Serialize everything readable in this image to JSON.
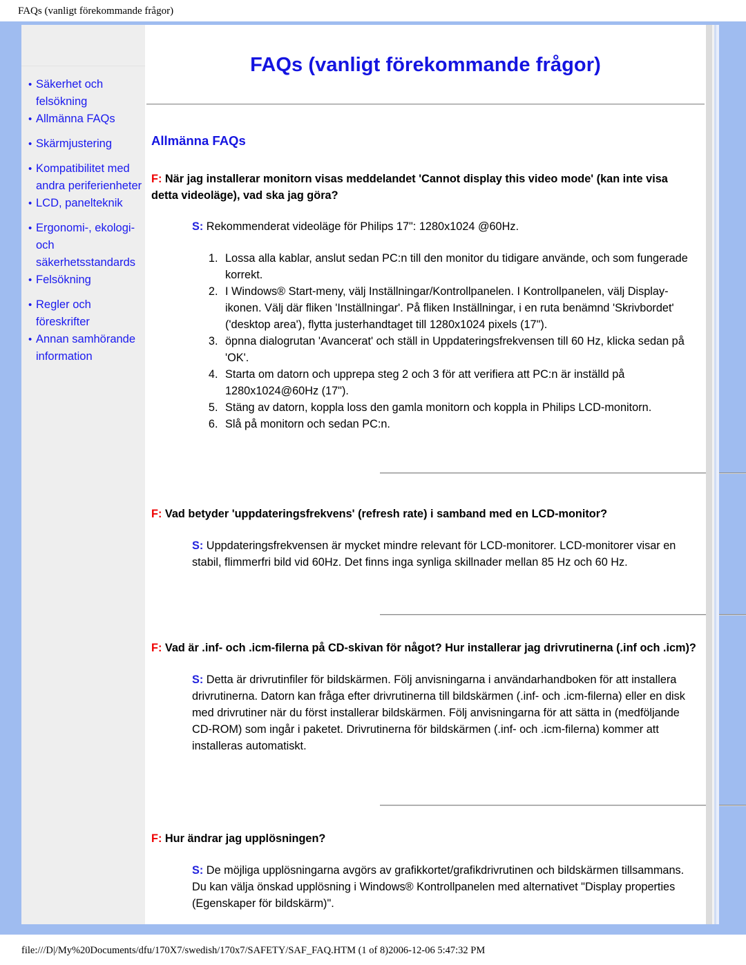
{
  "print": {
    "header": "FAQs (vanligt förekommande frågor)",
    "footer": "file:///D|/My%20Documents/dfu/170X7/swedish/170x7/SAFETY/SAF_FAQ.HTM (1 of 8)2006-12-06 5:47:32 PM"
  },
  "colors": {
    "frame_blue": "#9fbcf0",
    "sidebar_gray": "#eeeeee",
    "link_blue": "#1a1aee",
    "heading_blue": "#1414e0",
    "question_red": "#ee0000",
    "answer_blue": "#2222dd"
  },
  "sidebar": {
    "items": [
      {
        "label": "Säkerhet och felsökning",
        "gap": false
      },
      {
        "label": "Allmänna FAQs",
        "gap": false
      },
      {
        "label": "Skärmjustering",
        "gap": true
      },
      {
        "label": "Kompatibilitet med andra periferienheter",
        "gap": true
      },
      {
        "label": "LCD, panelteknik",
        "gap": false
      },
      {
        "label": "Ergonomi-, ekologi- och säkerhetsstandards",
        "gap": true
      },
      {
        "label": "Felsökning",
        "gap": false
      },
      {
        "label": "Regler och föreskrifter",
        "gap": true
      },
      {
        "label": "Annan samhörande information",
        "gap": false
      }
    ]
  },
  "main": {
    "title": "FAQs (vanligt förekommande frågor)",
    "section_title": "Allmänna FAQs",
    "q_marker": "F:",
    "a_marker": "S:",
    "qa": [
      {
        "question": "När jag installerar monitorn visas meddelandet 'Cannot display this video mode' (kan inte visa detta videoläge), vad ska jag göra?",
        "answer": "Rekommenderat videoläge för Philips 17\": 1280x1024 @60Hz.",
        "steps": [
          "Lossa alla kablar, anslut sedan PC:n till den monitor du tidigare använde, och som fungerade korrekt.",
          "I Windows® Start-meny, välj Inställningar/Kontrollpanelen. I Kontrollpanelen, välj Display-ikonen. Välj där fliken 'Inställningar'. På fliken Inställningar, i en ruta benämnd 'Skrivbordet' ('desktop area'), flytta justerhandtaget till 1280x1024 pixels (17\").",
          "öpnna dialogrutan 'Avancerat' och ställ in Uppdateringsfrekvensen till 60 Hz, klicka sedan på 'OK'.",
          "Starta om datorn och upprepa steg 2 och 3 för att verifiera att PC:n är inställd på 1280x1024@60Hz (17\").",
          "Stäng av datorn, koppla loss den gamla monitorn och koppla in Philips LCD-monitorn.",
          "Slå på monitorn och sedan PC:n."
        ]
      },
      {
        "question": "Vad betyder 'uppdateringsfrekvens' (refresh rate) i samband med en LCD-monitor?",
        "answer": "Uppdateringsfrekvensen är mycket mindre relevant för LCD-monitorer. LCD-monitorer visar en stabil, flimmerfri bild vid 60Hz. Det finns inga synliga skillnader mellan 85 Hz och 60 Hz.",
        "steps": []
      },
      {
        "question": "Vad är .inf- och .icm-filerna på CD-skivan för något? Hur installerar jag drivrutinerna (.inf och .icm)?",
        "answer": "Detta är drivrutinfiler för bildskärmen. Följ anvisningarna i användarhandboken för att installera drivrutinerna. Datorn kan fråga efter drivrutinerna till bildskärmen (.inf- och .icm-filerna) eller en disk med drivrutiner när du först installerar bildskärmen. Följ anvisningarna för att sätta in (medföljande CD-ROM) som ingår i paketet. Drivrutinerna för bildskärmen (.inf- och .icm-filerna) kommer att installeras automatiskt.",
        "steps": []
      },
      {
        "question": "Hur ändrar jag upplösningen?",
        "answer": "De möjliga upplösningarna avgörs av grafikkortet/grafikdrivrutinen och bildskärmen tillsammans. Du kan välja önskad upplösning i Windows® Kontrollpanelen med alternativet \"Display properties (Egenskaper för bildskärm)\".",
        "steps": []
      }
    ]
  }
}
